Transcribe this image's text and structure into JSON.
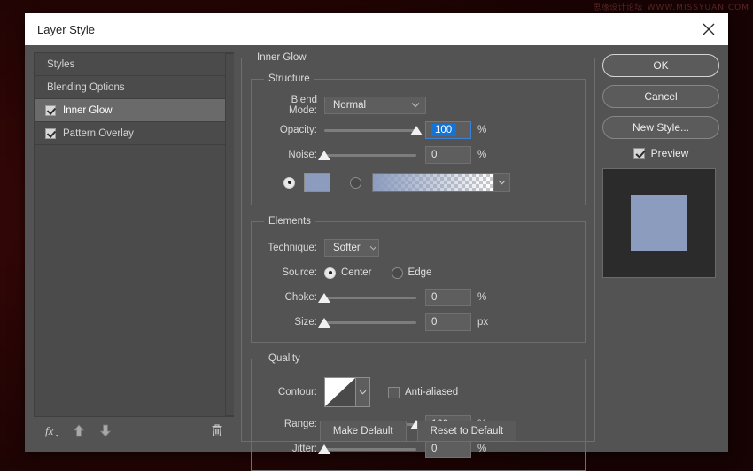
{
  "desktop": {
    "watermark_cn": "思缘设计论坛",
    "watermark_en": "WWW.MISSYUAN.COM"
  },
  "dialog": {
    "title": "Layer Style",
    "close_icon": "close-icon"
  },
  "styles_panel": {
    "items": [
      {
        "label": "Styles",
        "has_checkbox": false,
        "checked": false,
        "selected": false
      },
      {
        "label": "Blending Options",
        "has_checkbox": false,
        "checked": false,
        "selected": false
      },
      {
        "label": "Inner Glow",
        "has_checkbox": true,
        "checked": true,
        "selected": true
      },
      {
        "label": "Pattern Overlay",
        "has_checkbox": true,
        "checked": true,
        "selected": false
      }
    ],
    "toolbar": {
      "fx_icon": "fx-icon",
      "up_icon": "arrow-up-icon",
      "down_icon": "arrow-down-icon",
      "trash_icon": "trash-icon"
    }
  },
  "effect": {
    "group_title": "Inner Glow",
    "structure": {
      "title": "Structure",
      "blend_mode_label": "Blend Mode:",
      "blend_mode_value": "Normal",
      "opacity_label": "Opacity:",
      "opacity_value": "100",
      "opacity_unit": "%",
      "noise_label": "Noise:",
      "noise_value": "0",
      "noise_unit": "%",
      "fill_type": "color",
      "color_swatch": "#8c9cbe",
      "gradient_from": "#8c9cbe",
      "gradient_to": "transparent"
    },
    "elements": {
      "title": "Elements",
      "technique_label": "Technique:",
      "technique_value": "Softer",
      "source_label": "Source:",
      "source_center_label": "Center",
      "source_edge_label": "Edge",
      "source_value": "Center",
      "choke_label": "Choke:",
      "choke_value": "0",
      "choke_unit": "%",
      "size_label": "Size:",
      "size_value": "0",
      "size_unit": "px"
    },
    "quality": {
      "title": "Quality",
      "contour_label": "Contour:",
      "anti_aliased_label": "Anti-aliased",
      "anti_aliased_checked": false,
      "range_label": "Range:",
      "range_value": "100",
      "range_unit": "%",
      "jitter_label": "Jitter:",
      "jitter_value": "0",
      "jitter_unit": "%"
    }
  },
  "footer": {
    "make_default": "Make Default",
    "reset_to_default": "Reset to Default"
  },
  "actions": {
    "ok": "OK",
    "cancel": "Cancel",
    "new_style": "New Style...",
    "preview_label": "Preview",
    "preview_checked": true,
    "preview_swatch_color": "#8c9cbe"
  }
}
